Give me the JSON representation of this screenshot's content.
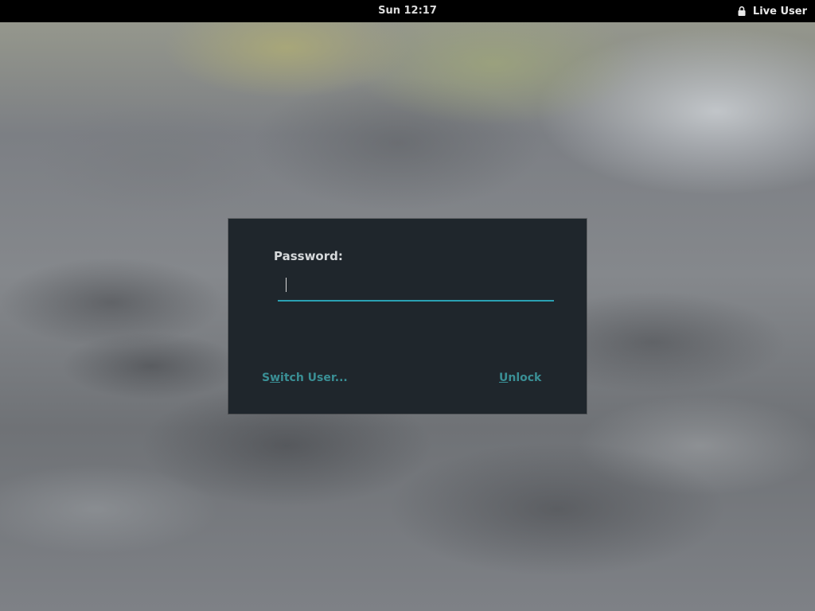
{
  "topbar": {
    "clock": "Sun 12:17",
    "user": {
      "icon": "lock-icon",
      "name": "Live User"
    }
  },
  "dialog": {
    "password_label": "Password:",
    "password_value": "",
    "switch_user": {
      "mnemonic_prefix": "S",
      "mnemonic_char": "w",
      "rest": "itch User..."
    },
    "unlock": {
      "mnemonic_char": "U",
      "rest": "nlock"
    }
  },
  "colors": {
    "topbar_bg": "#000000",
    "dialog_bg": "#1f262c",
    "accent_underline": "#2aa1b3",
    "button_text": "#3a8f95"
  }
}
